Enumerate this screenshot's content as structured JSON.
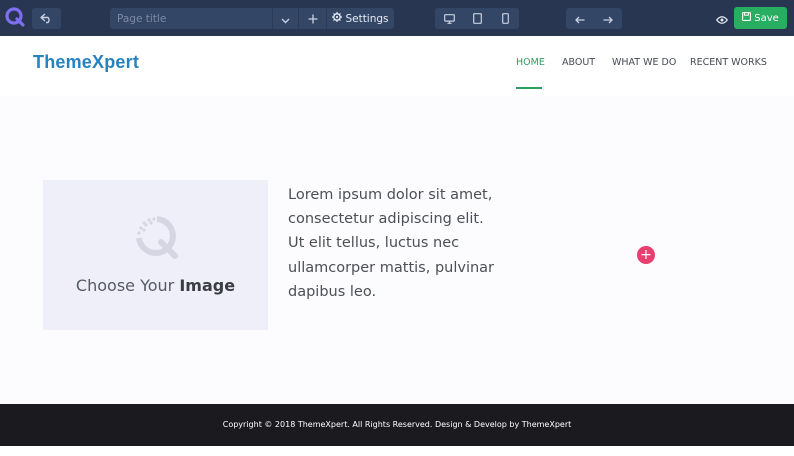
{
  "toolbar": {
    "page_title_placeholder": "Page title",
    "settings_label": "Settings",
    "save_label": "Save",
    "icons": {
      "logo": "quix-logo-icon",
      "undo": "undo-icon",
      "dropdown": "chevron-down-icon",
      "add": "plus-icon",
      "settings": "gear-icon",
      "desktop": "desktop-icon",
      "tablet": "tablet-icon",
      "mobile": "mobile-icon",
      "back": "arrow-left-icon",
      "forward": "arrow-right-icon",
      "preview": "eye-icon",
      "save": "save-icon"
    }
  },
  "site": {
    "brand": "ThemeXpert",
    "nav": [
      {
        "label": "HOME",
        "active": true
      },
      {
        "label": "ABOUT",
        "active": false
      },
      {
        "label": "WHAT WE DO",
        "active": false
      },
      {
        "label": "RECENT WORKS",
        "active": false
      }
    ]
  },
  "content": {
    "image_placeholder": {
      "prefix": "Choose Your ",
      "bold": "Image"
    },
    "paragraph": "Lorem ipsum dolor sit amet, consectetur adipiscing elit. Ut elit tellus, luctus nec ullamcorper mattis, pulvinar dapibus leo.",
    "add_button_label": "+"
  },
  "footer": {
    "copyright": "Copyright © 2018 ThemeXpert. All Rights Reserved. Design & Develop by ThemeXpert"
  },
  "colors": {
    "toolbar_bg": "#283651",
    "toolbar_btn": "#344666",
    "accent_green": "#27ae60",
    "brand_blue": "#2782c0",
    "fab_pink": "#e83f6f",
    "footer_bg": "#1b1b1f"
  }
}
